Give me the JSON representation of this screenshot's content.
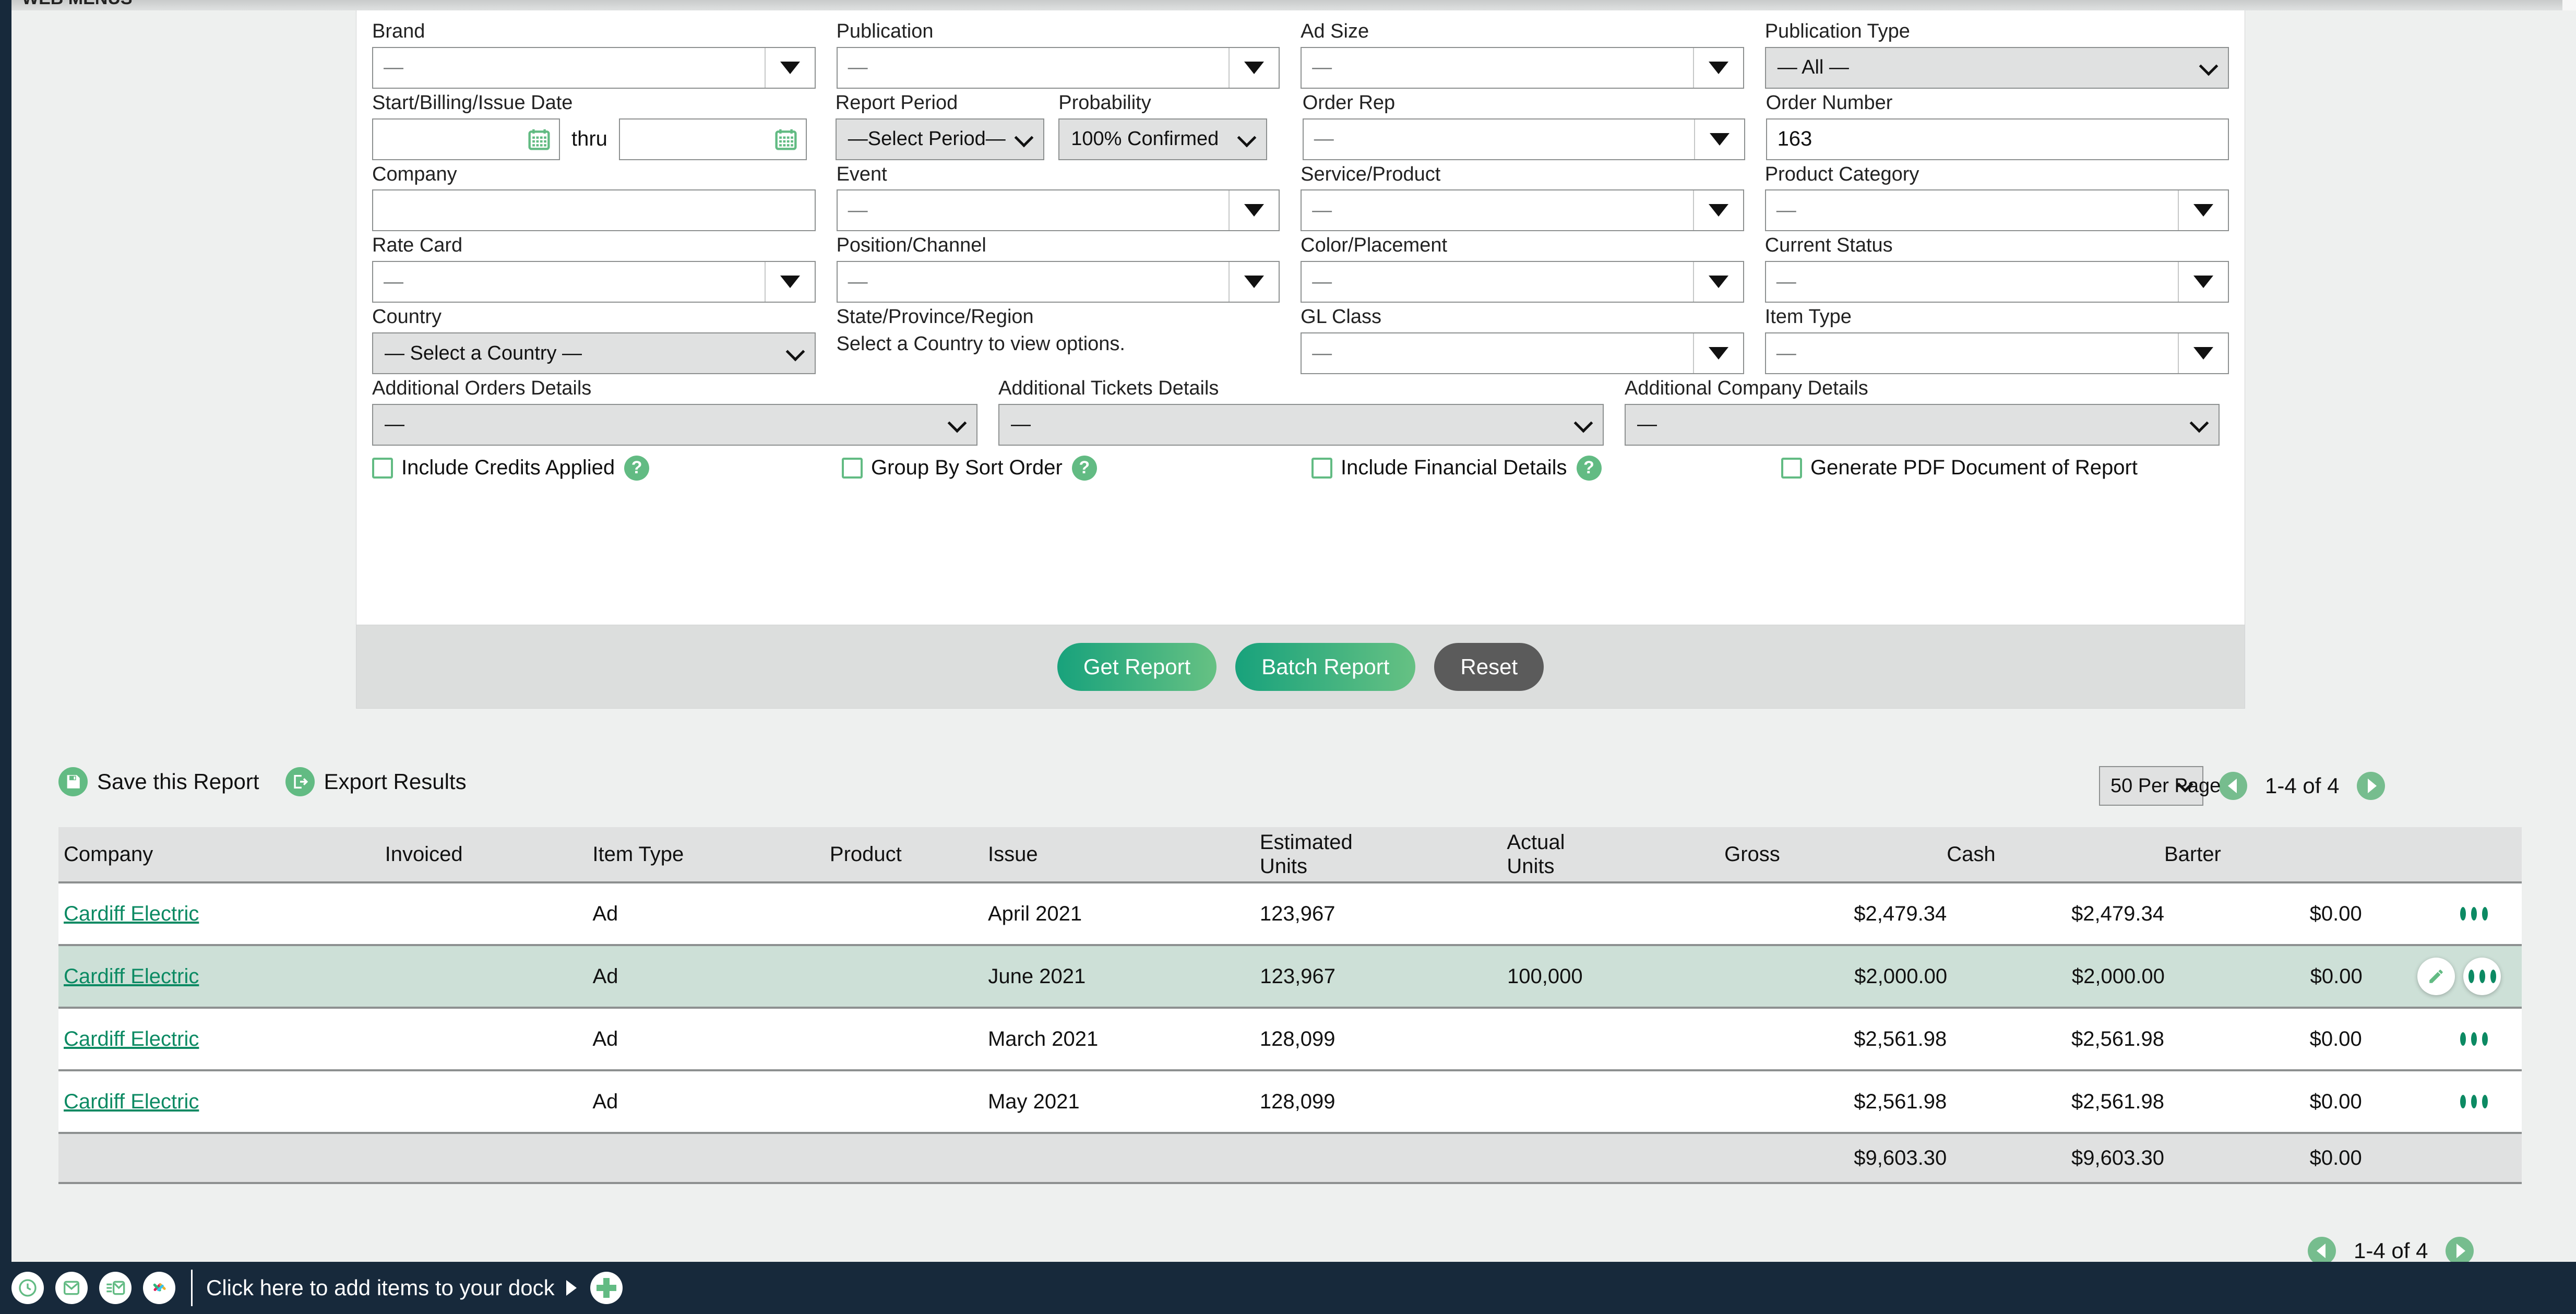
{
  "window": {
    "cut_off_menu_text": "WEB MENUS"
  },
  "filters": {
    "row1": [
      {
        "label": "Brand",
        "value": "—",
        "type": "combo"
      },
      {
        "label": "Publication",
        "value": "—",
        "type": "combo"
      },
      {
        "label": "Ad Size",
        "value": "—",
        "type": "combo"
      },
      {
        "label": "Publication Type",
        "value": "— All —",
        "type": "select"
      }
    ],
    "date_range": {
      "label": "Start/Billing/Issue Date",
      "from_value": "",
      "thru_label": "thru",
      "to_value": "",
      "calendar_icon": "calendar-icon"
    },
    "report_period": {
      "label": "Report Period",
      "value": "—Select Period—"
    },
    "probability": {
      "label": "Probability",
      "value": "100% Confirmed"
    },
    "order_rep": {
      "label": "Order Rep",
      "value": "—"
    },
    "order_number": {
      "label": "Order Number",
      "value": "163"
    },
    "company": {
      "label": "Company",
      "value": ""
    },
    "event": {
      "label": "Event",
      "value": "—"
    },
    "service_product": {
      "label": "Service/Product",
      "value": "—"
    },
    "product_category": {
      "label": "Product Category",
      "value": "—"
    },
    "rate_card": {
      "label": "Rate Card",
      "value": "—"
    },
    "position_channel": {
      "label": "Position/Channel",
      "value": "—"
    },
    "color_placement": {
      "label": "Color/Placement",
      "value": "—"
    },
    "current_status": {
      "label": "Current Status",
      "value": "—"
    },
    "country": {
      "label": "Country",
      "value": "— Select a Country —"
    },
    "state_province": {
      "label": "State/Province/Region",
      "note": "Select a Country to view options."
    },
    "gl_class": {
      "label": "GL Class",
      "value": "—"
    },
    "item_type": {
      "label": "Item Type",
      "value": "—"
    },
    "additional_orders": {
      "label": "Additional Orders Details",
      "value": "—"
    },
    "additional_tickets": {
      "label": "Additional Tickets Details",
      "value": "—"
    },
    "additional_company": {
      "label": "Additional Company Details",
      "value": "—"
    },
    "checkboxes": [
      {
        "label": "Include Credits Applied",
        "checked": false,
        "help": true
      },
      {
        "label": "Group By Sort Order",
        "checked": false,
        "help": true
      },
      {
        "label": "Include Financial Details",
        "checked": false,
        "help": true
      },
      {
        "label": "Generate PDF Document of Report",
        "checked": false,
        "help": false
      }
    ]
  },
  "buttons": {
    "get_report": "Get Report",
    "batch_report": "Batch Report",
    "reset": "Reset"
  },
  "actions": {
    "save_report": "Save this Report",
    "export_results": "Export Results"
  },
  "pagination": {
    "per_page": "50 Per Page",
    "count": "1-4 of 4"
  },
  "results": {
    "columns": [
      "Company",
      "Invoiced",
      "Item Type",
      "Product",
      "Issue",
      "Estimated Units",
      "Actual Units",
      "Gross",
      "Cash",
      "Barter"
    ],
    "column_lines": [
      [
        "Company",
        ""
      ],
      [
        "Invoiced",
        ""
      ],
      [
        "Item Type",
        ""
      ],
      [
        "Product",
        ""
      ],
      [
        "Issue",
        ""
      ],
      [
        "Estimated",
        "Units"
      ],
      [
        "Actual",
        "Units"
      ],
      [
        "Gross",
        ""
      ],
      [
        "Cash",
        ""
      ],
      [
        "Barter",
        ""
      ]
    ],
    "rows": [
      {
        "company": "Cardiff Electric",
        "invoiced": "",
        "item_type": "Ad",
        "product": "",
        "issue": "April 2021",
        "estimated_units": "123,967",
        "actual_units": "",
        "gross": "$2,479.34",
        "cash": "$2,479.34",
        "barter": "$0.00",
        "highlighted": false,
        "hover": false
      },
      {
        "company": "Cardiff Electric",
        "invoiced": "",
        "item_type": "Ad",
        "product": "",
        "issue": "June 2021",
        "estimated_units": "123,967",
        "actual_units": "100,000",
        "gross": "$2,000.00",
        "cash": "$2,000.00",
        "barter": "$0.00",
        "highlighted": true,
        "hover": true
      },
      {
        "company": "Cardiff Electric",
        "invoiced": "",
        "item_type": "Ad",
        "product": "",
        "issue": "March 2021",
        "estimated_units": "128,099",
        "actual_units": "",
        "gross": "$2,561.98",
        "cash": "$2,561.98",
        "barter": "$0.00",
        "highlighted": false,
        "hover": false
      },
      {
        "company": "Cardiff Electric",
        "invoiced": "",
        "item_type": "Ad",
        "product": "",
        "issue": "May 2021",
        "estimated_units": "128,099",
        "actual_units": "",
        "gross": "$2,561.98",
        "cash": "$2,561.98",
        "barter": "$0.00",
        "highlighted": false,
        "hover": false
      }
    ],
    "totals": {
      "gross": "$9,603.30",
      "cash": "$9,603.30",
      "barter": "$0.00"
    }
  },
  "dock": {
    "hint": "Click here to add items to your dock",
    "icons": [
      "clock-icon",
      "envelope-icon",
      "document-envelope-icon",
      "slack-icon"
    ],
    "add_icon": "plus-icon"
  },
  "colors": {
    "accent_green": "#62bb83",
    "link_green": "#0c8a63",
    "button_green": "#18a27c",
    "row_highlight": "#cde0d7",
    "dock_navy": "#17293b"
  }
}
